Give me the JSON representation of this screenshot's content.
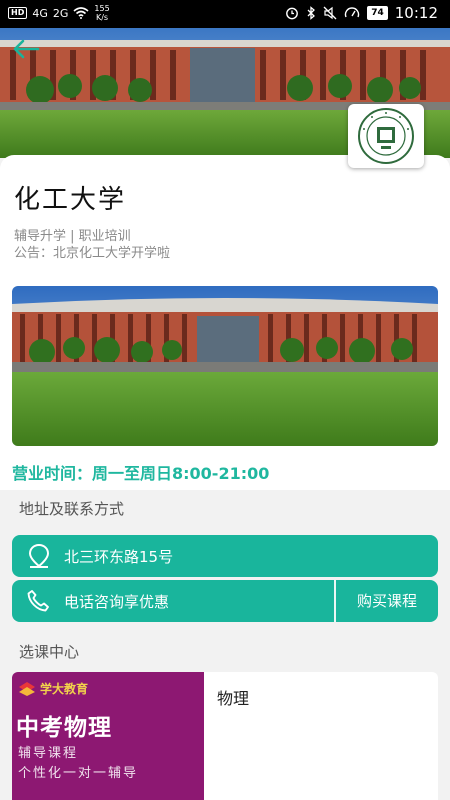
{
  "status_bar": {
    "network_badge": "HD",
    "signal_1": "4G",
    "signal_2": "2G",
    "speed_value": "155",
    "speed_unit": "K/s",
    "battery": "74",
    "time": "10:12"
  },
  "school": {
    "name": "化工大学",
    "tags": "辅导升学 | 职业培训",
    "notice": "公告：北京化工大学开学啦"
  },
  "business_hours": "营业时间：周一至周日8:00-21:00",
  "contact": {
    "section_title": "地址及联系方式",
    "address": "北三环东路15号",
    "phone_label": "电话咨询享优惠",
    "buy_label": "购买课程"
  },
  "courses": {
    "section_title": "选课中心",
    "items": [
      {
        "brand": "学大教育",
        "headline": "中考物理",
        "line1": "辅导课程",
        "line2": "个性化一对一辅导",
        "title": "物理"
      }
    ]
  },
  "colors": {
    "accent": "#19b59c",
    "accent_text": "#1fb79f",
    "course_bg": "#8d1872"
  },
  "icons": [
    "back-arrow-icon",
    "location-pin-icon",
    "phone-icon",
    "school-logo-icon",
    "brand-logo-icon"
  ]
}
